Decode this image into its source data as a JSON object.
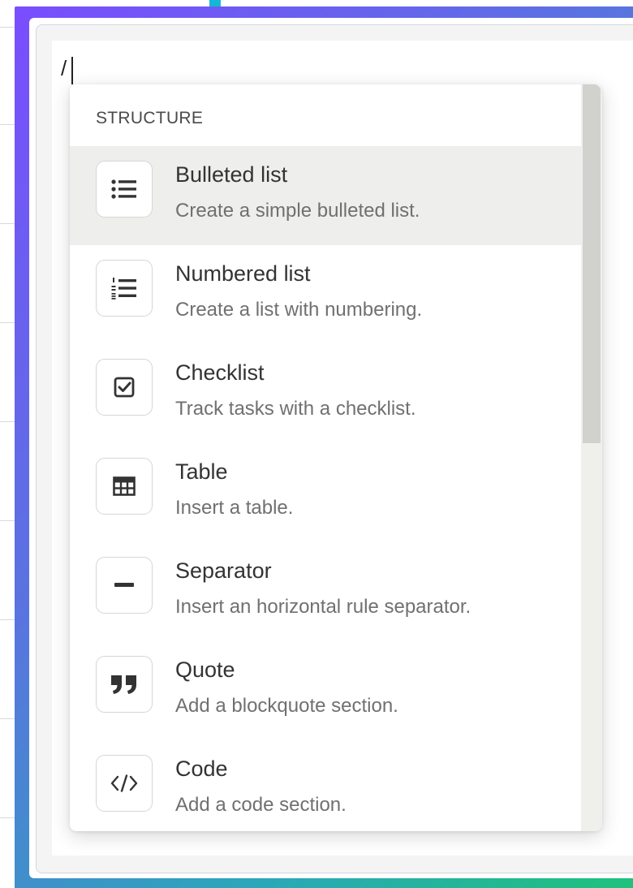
{
  "editor": {
    "typed_text": "/"
  },
  "menu": {
    "section_label": "STRUCTURE",
    "active_index": 0,
    "items": [
      {
        "title": "Bulleted list",
        "description": "Create a simple bulleted list.",
        "icon": "bulleted-list-icon"
      },
      {
        "title": "Numbered list",
        "description": "Create a list with numbering.",
        "icon": "numbered-list-icon"
      },
      {
        "title": "Checklist",
        "description": "Track tasks with a checklist.",
        "icon": "checklist-icon"
      },
      {
        "title": "Table",
        "description": "Insert a table.",
        "icon": "table-icon"
      },
      {
        "title": "Separator",
        "description": "Insert an horizontal rule separator.",
        "icon": "separator-icon"
      },
      {
        "title": "Quote",
        "description": "Add a blockquote section.",
        "icon": "quote-icon"
      },
      {
        "title": "Code",
        "description": "Add a code section.",
        "icon": "code-icon"
      }
    ]
  },
  "colors": {
    "frame_gradient_start": "#7a4dff",
    "frame_gradient_end": "#1fc27a",
    "active_item_bg": "#eeeeed",
    "icon_color": "#333333"
  }
}
